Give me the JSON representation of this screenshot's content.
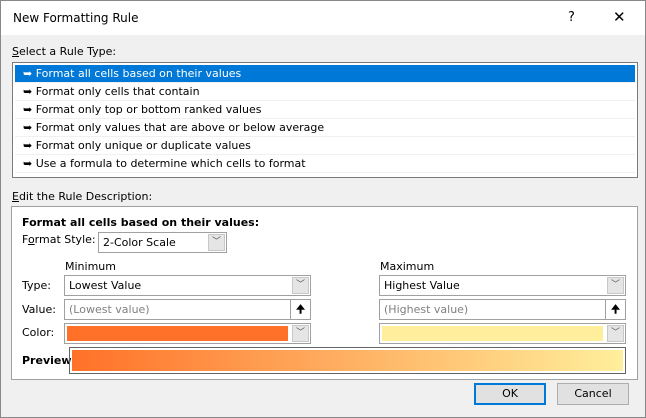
{
  "window": {
    "title": "New Formatting Rule",
    "help": "?",
    "close": "✕"
  },
  "rule_type": {
    "label_accel": "S",
    "label_rest": "elect a Rule Type:",
    "items": [
      {
        "label": "Format all cells based on their values",
        "selected": true
      },
      {
        "label": "Format only cells that contain"
      },
      {
        "label": "Format only top or bottom ranked values"
      },
      {
        "label": "Format only values that are above or below average"
      },
      {
        "label": "Format only unique or duplicate values"
      },
      {
        "label": "Use a formula to determine which cells to format"
      }
    ],
    "bullet": "➥"
  },
  "description": {
    "label_accel": "E",
    "label_rest": "dit the Rule Description:",
    "heading": "Format all cells based on their values:",
    "format_style_label_a": "F",
    "format_style_label_b": "o",
    "format_style_label_c": "rmat Style:",
    "format_style": "2-Color Scale",
    "type_label": "Type:",
    "value_label": "Value:",
    "color_label": "Color:",
    "minimum": {
      "header": "Minimum",
      "type": "Lowest Value",
      "value_placeholder": "(Lowest value)",
      "color": "#ff7128"
    },
    "maximum": {
      "header": "Maximum",
      "type": "Highest Value",
      "value_placeholder": "(Highest value)",
      "color": "#ffef9c"
    },
    "preview_label": "Preview:"
  },
  "buttons": {
    "ok": "OK",
    "cancel": "Cancel"
  },
  "icons": {
    "dropdown": "chevron-down-icon",
    "collapse": "upload-arrow-icon"
  }
}
